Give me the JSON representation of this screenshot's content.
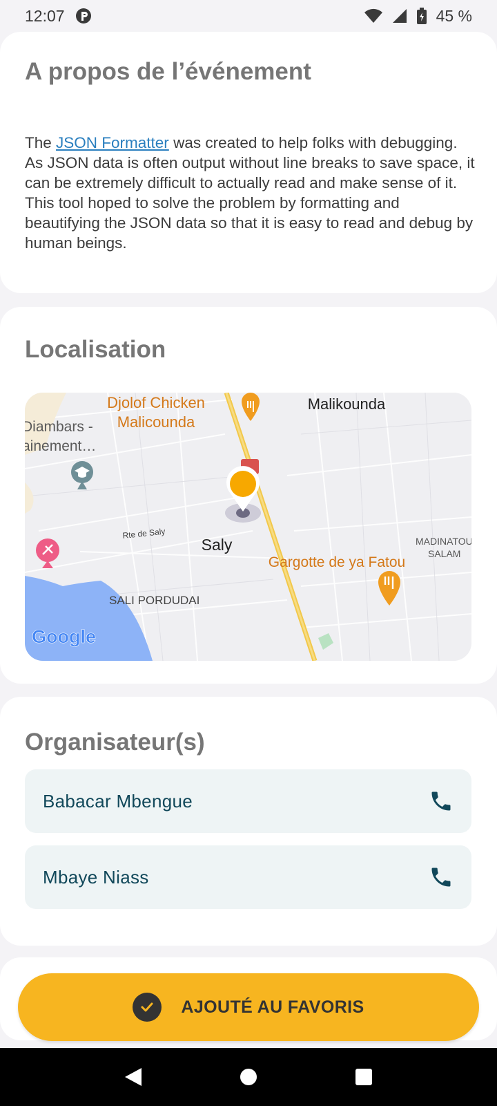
{
  "status_bar": {
    "time": "12:07",
    "battery": "45 %",
    "icons": [
      "app-notification-icon",
      "wifi-icon",
      "cell-signal-icon",
      "battery-icon"
    ]
  },
  "about": {
    "title": "A propos de l’événement",
    "text_before": "The ",
    "link_text": "JSON Formatter",
    "text_after": " was created to help folks with debugging. As JSON data is often output without line breaks to save space, it can be extremely difficult to actually read and make sense of it. This tool hoped to solve the problem by formatting and beautifying the JSON data so that it is easy to read and debug by human beings."
  },
  "location": {
    "title": "Localisation",
    "map_labels": {
      "restaurant_1_line1": "Djolof Chicken",
      "restaurant_1_line2": "Malicounda",
      "place_1": "Malikounda",
      "school_line1": "Diambars -",
      "school_line2": "ainement…",
      "road": "Rte de Saly",
      "town": "Saly",
      "district_1_line1": "MADINATOU",
      "district_1_line2": "SALAM",
      "restaurant_2": "Gargotte de ya Fatou",
      "district_2": "SALI PORDUDAI",
      "provider": "Google"
    }
  },
  "organizers": {
    "title": "Organisateur(s)",
    "items": [
      {
        "name": "Babacar Mbengue"
      },
      {
        "name": "Mbaye Niass"
      }
    ]
  },
  "favorite_button": {
    "label": "AJOUTÉ AU FAVORIS"
  },
  "colors": {
    "accent": "#f7b520",
    "org_text": "#11485a",
    "link": "#2a7fbf"
  }
}
